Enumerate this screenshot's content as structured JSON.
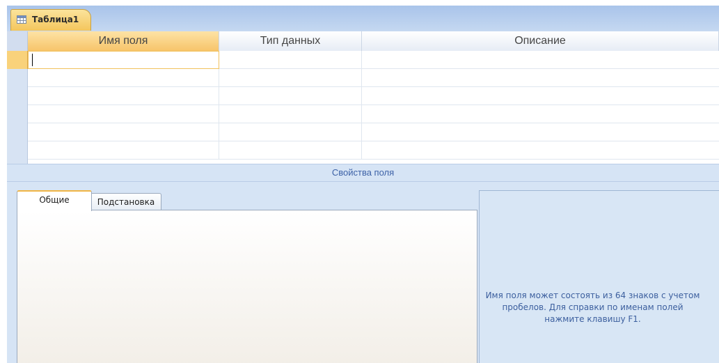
{
  "document_tab": {
    "title": "Таблица1",
    "icon": "table-icon"
  },
  "grid": {
    "columns": [
      "Имя поля",
      "Тип данных",
      "Описание"
    ],
    "rows": [
      {
        "name": "",
        "type": "",
        "description": ""
      },
      {
        "name": "",
        "type": "",
        "description": ""
      },
      {
        "name": "",
        "type": "",
        "description": ""
      },
      {
        "name": "",
        "type": "",
        "description": ""
      },
      {
        "name": "",
        "type": "",
        "description": ""
      },
      {
        "name": "",
        "type": "",
        "description": ""
      }
    ]
  },
  "properties": {
    "header": "Свойства поля",
    "tabs": [
      "Общие",
      "Подстановка"
    ],
    "active_tab": "Общие",
    "help_text": "Имя поля может состоять из 64 знаков с учетом\nпробелов.  Для справки по именам полей\nнажмите клавишу F1."
  },
  "colors": {
    "accent": "#f7c46a",
    "bar": "#a9c4ea",
    "panel": "#d6e4f5",
    "help_text": "#3c5f9e"
  }
}
